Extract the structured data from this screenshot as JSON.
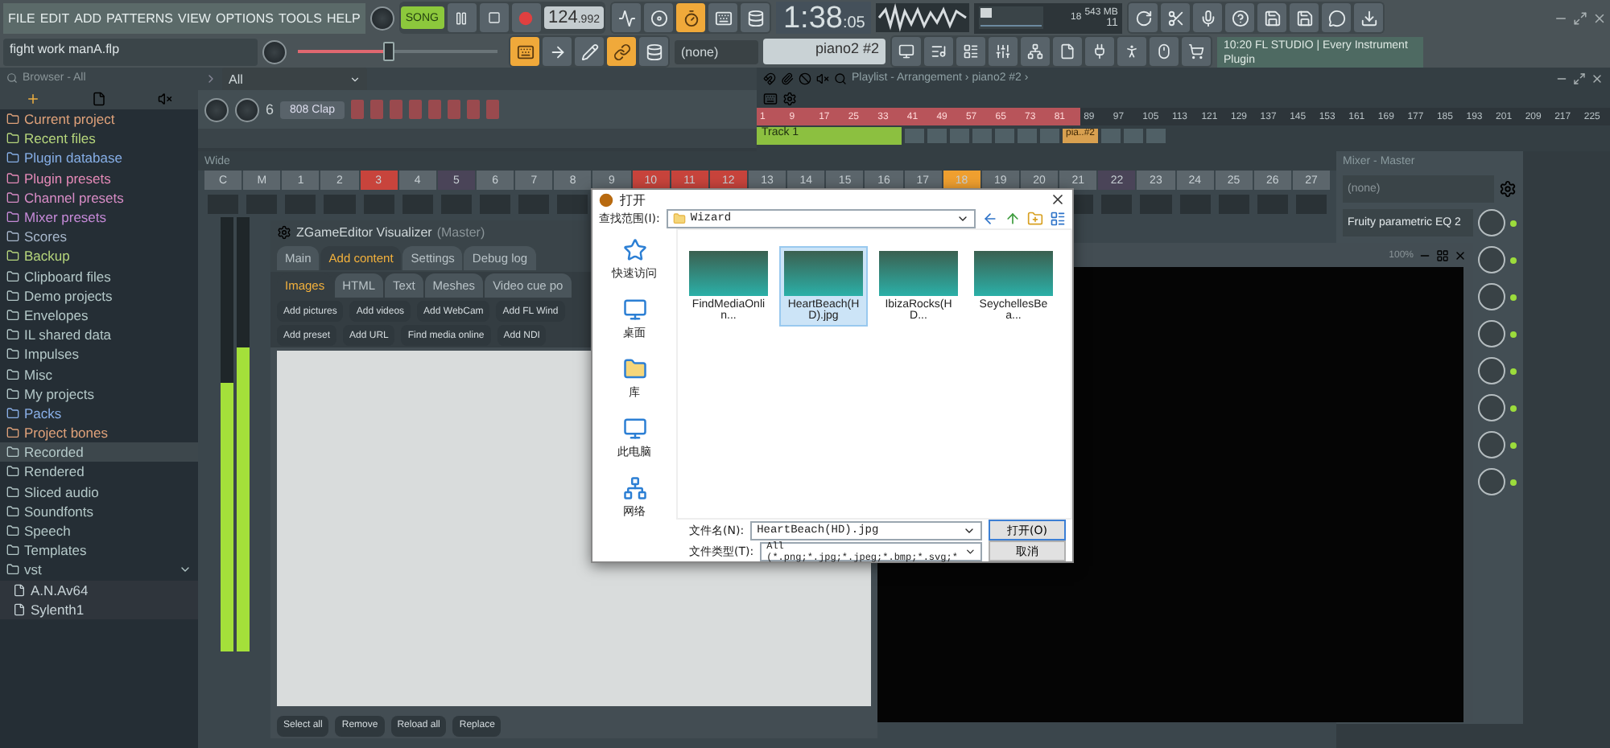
{
  "menu": [
    "FILE",
    "EDIT",
    "ADD",
    "PATTERNS",
    "VIEW",
    "OPTIONS",
    "TOOLS",
    "HELP"
  ],
  "project_file": "fight work manA.flp",
  "transport": {
    "mode": "SONG",
    "song_mode": true,
    "tempo": "124",
    "tempo_fraction": ".992",
    "time": "1:38",
    "time_fraction": ":05"
  },
  "pitch": {
    "level": 0.45
  },
  "performance": {
    "cpu": "18",
    "memory": "543 MB",
    "polyphony": "11"
  },
  "tool_buttons": [
    {
      "on": false
    },
    {
      "on": false
    },
    {
      "on": true
    },
    {
      "on": false
    },
    {
      "on": false
    }
  ],
  "tool_buttons_2": [
    {
      "on": true
    },
    {
      "on": false
    },
    {
      "on": false
    },
    {
      "on": true
    },
    {
      "on": false
    }
  ],
  "pattern_selector": {
    "none_label": "(none)",
    "pattern": "piano2 #2"
  },
  "hint": {
    "time": "10:20",
    "text": "FL STUDIO | Every Instrument Plugin"
  },
  "browser": {
    "title": "Browser - All",
    "items": [
      {
        "label": "Current project",
        "color": "#e0a27a",
        "selected": false
      },
      {
        "label": "Recent files",
        "color": "#b6d67c",
        "selected": false
      },
      {
        "label": "Plugin database",
        "color": "#86aee6",
        "selected": false
      },
      {
        "label": "Plugin presets",
        "color": "#e58ab8",
        "selected": false
      },
      {
        "label": "Channel presets",
        "color": "#d88cc6",
        "selected": false
      },
      {
        "label": "Mixer presets",
        "color": "#c68ad8",
        "selected": false
      },
      {
        "label": "Scores",
        "color": "#a8b8cc",
        "selected": false
      },
      {
        "label": "Backup",
        "color": "#b6d67c",
        "selected": false
      },
      {
        "label": "Clipboard files",
        "color": "#b4c8c8",
        "selected": false
      },
      {
        "label": "Demo projects",
        "color": "#b4c8c8",
        "selected": false
      },
      {
        "label": "Envelopes",
        "color": "#b4c8c8",
        "selected": false
      },
      {
        "label": "IL shared data",
        "color": "#b4c8c8",
        "selected": false
      },
      {
        "label": "Impulses",
        "color": "#b4c8c8",
        "selected": false
      },
      {
        "label": "Misc",
        "color": "#b4c8c8",
        "selected": false
      },
      {
        "label": "My projects",
        "color": "#b4c8c8",
        "selected": false
      },
      {
        "label": "Packs",
        "color": "#8ab0e8",
        "selected": false
      },
      {
        "label": "Project bones",
        "color": "#e0a27a",
        "selected": false
      },
      {
        "label": "Recorded",
        "color": "#b4c8c8",
        "selected": true
      },
      {
        "label": "Rendered",
        "color": "#b4c8c8",
        "selected": false
      },
      {
        "label": "Sliced audio",
        "color": "#b4c8c8",
        "selected": false
      },
      {
        "label": "Soundfonts",
        "color": "#b4c8c8",
        "selected": false
      },
      {
        "label": "Speech",
        "color": "#b4c8c8",
        "selected": false
      },
      {
        "label": "Templates",
        "color": "#b4c8c8",
        "selected": false
      },
      {
        "label": "vst",
        "color": "#b4c8c8",
        "selected": false,
        "expanded": true,
        "children": [
          {
            "label": "A.N.Av64",
            "color": "#c8d4d8",
            "selected": false
          },
          {
            "label": "Sylenth1",
            "color": "#c8d4d8",
            "selected": false
          }
        ]
      }
    ]
  },
  "channel_rack": {
    "filter": "All",
    "swing": "6",
    "channel": "808 Clap"
  },
  "playlist": {
    "title": "Playlist - Arrangement ›",
    "pattern": "piano2 #2 ›",
    "track": "Track 1",
    "clip": "pia..#2",
    "ruler": [
      {
        "label": "1",
        "in_loop": true
      },
      {
        "label": "9",
        "in_loop": true
      },
      {
        "label": "17",
        "in_loop": true
      },
      {
        "label": "25",
        "in_loop": true
      },
      {
        "label": "33",
        "in_loop": true
      },
      {
        "label": "41",
        "in_loop": true
      },
      {
        "label": "49",
        "in_loop": true
      },
      {
        "label": "57",
        "in_loop": true
      },
      {
        "label": "65",
        "in_loop": true
      },
      {
        "label": "73",
        "in_loop": true
      },
      {
        "label": "81",
        "in_loop": true
      },
      {
        "label": "89",
        "in_loop": false
      },
      {
        "label": "97",
        "in_loop": false
      },
      {
        "label": "105",
        "in_loop": false
      },
      {
        "label": "113",
        "in_loop": false
      },
      {
        "label": "121",
        "in_loop": false
      },
      {
        "label": "129",
        "in_loop": false
      },
      {
        "label": "137",
        "in_loop": false
      },
      {
        "label": "145",
        "in_loop": false
      },
      {
        "label": "153",
        "in_loop": false
      },
      {
        "label": "161",
        "in_loop": false
      },
      {
        "label": "169",
        "in_loop": false
      },
      {
        "label": "177",
        "in_loop": false
      },
      {
        "label": "185",
        "in_loop": false
      },
      {
        "label": "193",
        "in_loop": false
      },
      {
        "label": "201",
        "in_loop": false
      },
      {
        "label": "209",
        "in_loop": false
      },
      {
        "label": "217",
        "in_loop": false
      },
      {
        "label": "225",
        "in_loop": false
      }
    ]
  },
  "mixer": {
    "view": "Wide",
    "master_levels": [
      {
        "level": 0.62
      },
      {
        "level": 0.7
      }
    ],
    "strips": [
      {
        "label": "C",
        "color": "#5c666c"
      },
      {
        "label": "M",
        "color": "#5c666c"
      },
      {
        "label": "1",
        "color": "#5c666c"
      },
      {
        "label": "2",
        "color": "#5c666c"
      },
      {
        "label": "3",
        "color": "#c8443c"
      },
      {
        "label": "4",
        "color": "#5c666c"
      },
      {
        "label": "5",
        "color": "#4a4458"
      },
      {
        "label": "6",
        "color": "#5c666c"
      },
      {
        "label": "7",
        "color": "#5c666c"
      },
      {
        "label": "8",
        "color": "#5c666c"
      },
      {
        "label": "9",
        "color": "#5c666c"
      },
      {
        "label": "10",
        "color": "#c8443c"
      },
      {
        "label": "11",
        "color": "#c8443c"
      },
      {
        "label": "12",
        "color": "#c8443c"
      },
      {
        "label": "13",
        "color": "#5c666c"
      },
      {
        "label": "14",
        "color": "#5c666c"
      },
      {
        "label": "15",
        "color": "#5c666c"
      },
      {
        "label": "16",
        "color": "#5c666c"
      },
      {
        "label": "17",
        "color": "#5c666c"
      },
      {
        "label": "18",
        "color": "#f0a030"
      },
      {
        "label": "19",
        "color": "#5c666c"
      },
      {
        "label": "20",
        "color": "#5c666c"
      },
      {
        "label": "21",
        "color": "#5c666c"
      },
      {
        "label": "22",
        "color": "#4a4458"
      },
      {
        "label": "23",
        "color": "#5c666c"
      },
      {
        "label": "24",
        "color": "#5c666c"
      },
      {
        "label": "25",
        "color": "#5c666c"
      },
      {
        "label": "26",
        "color": "#5c666c"
      },
      {
        "label": "27",
        "color": "#5c666c"
      }
    ]
  },
  "visualizer": {
    "title": "ZGameEditor Visualizer",
    "target": "(Master)",
    "tabs": [
      {
        "label": "Main",
        "selected": false
      },
      {
        "label": "Add content",
        "selected": true
      },
      {
        "label": "Settings",
        "selected": false
      },
      {
        "label": "Debug log",
        "selected": false
      }
    ],
    "subtabs": [
      {
        "label": "Images",
        "selected": true
      },
      {
        "label": "HTML",
        "selected": false
      },
      {
        "label": "Text",
        "selected": false
      },
      {
        "label": "Meshes",
        "selected": false
      },
      {
        "label": "Video cue po",
        "selected": false
      }
    ],
    "buttons": [
      [
        "Add pictures",
        "Add videos",
        "Add WebCam",
        "Add FL Wind"
      ],
      [
        "Add preset",
        "Add URL",
        "Find media online",
        "Add NDI"
      ]
    ],
    "bottom_buttons": [
      "Select all",
      "Remove",
      "Reload all",
      "Replace"
    ],
    "zoom": "100%"
  },
  "mixer_master": {
    "title": "Mixer - Master",
    "input": "(none)",
    "slots": [
      {
        "name": "Fruity parametric EQ 2",
        "on": true
      },
      {
        "on": true
      },
      {
        "on": true
      },
      {
        "on": true
      },
      {
        "on": true
      },
      {
        "on": true
      },
      {
        "on": true
      },
      {
        "on": true
      }
    ]
  },
  "dialog": {
    "title": "打开",
    "look_in_label": "查找范围(I):",
    "look_in": "Wizard",
    "places": [
      "快速访问",
      "桌面",
      "库",
      "此电脑",
      "网络"
    ],
    "files": [
      {
        "name": "FindMediaOnlin...",
        "selected": false
      },
      {
        "name": "HeartBeach(HD).jpg",
        "selected": true
      },
      {
        "name": "IbizaRocks(HD...",
        "selected": false
      },
      {
        "name": "SeychellesBea...",
        "selected": false
      }
    ],
    "file_name_label": "文件名(N):",
    "file_name": "HeartBeach(HD).jpg",
    "file_type_label": "文件类型(T):",
    "file_type": "All (*.png;*.jpg;*.jpeg;*.bmp;*.svg;*",
    "open_button": "打开(O)",
    "cancel_button": "取消"
  }
}
